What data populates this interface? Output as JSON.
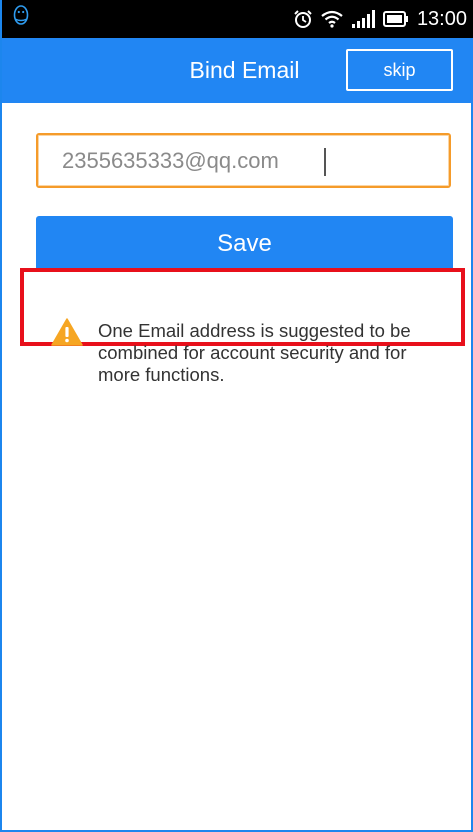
{
  "status_bar": {
    "time": "13:00",
    "icons": [
      "qq-penguin-icon",
      "alarm-icon",
      "wifi-icon",
      "signal-icon",
      "battery-icon"
    ]
  },
  "header": {
    "title": "Bind Email",
    "skip_label": "skip"
  },
  "form": {
    "email_value": "2355635333@qq.com",
    "save_label": "Save"
  },
  "notice": {
    "icon": "warning-icon",
    "text": "One Email address is suggested to be combined for account security and for more functions."
  },
  "colors": {
    "primary": "#2186f3",
    "input_border": "#f59b2a",
    "highlight": "#e8101b",
    "warning": "#f6a623"
  }
}
